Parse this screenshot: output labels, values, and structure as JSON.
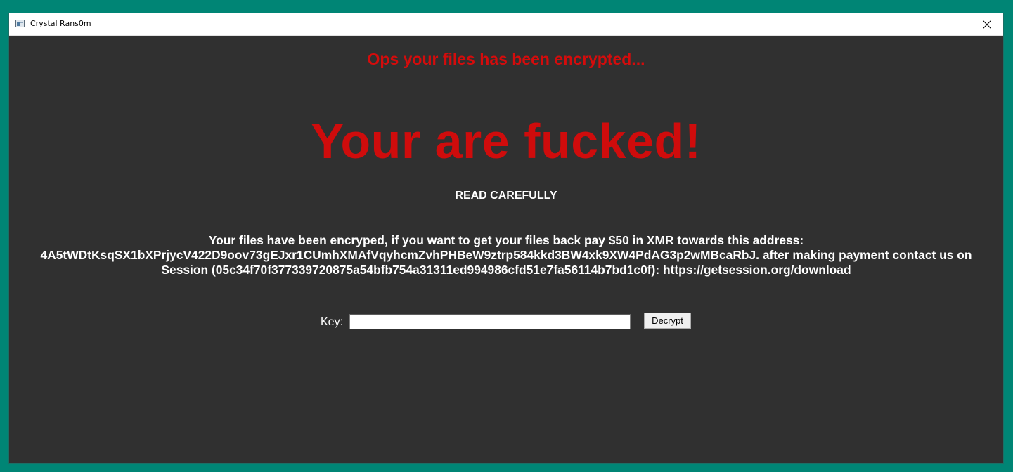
{
  "window": {
    "title": "Crystal Rans0m",
    "close_icon": "close-icon",
    "app_icon": "window-app-icon"
  },
  "content": {
    "subtitle": "Ops your files has been encrypted...",
    "headline": "Your are fucked!",
    "read_label": "READ CAREFULLY",
    "message_line1": "Your files have been encryped, if you want to get your files back pay $50 in XMR towards this address:",
    "message_line2": "4A5tWDtKsqSX1bXPrjycV422D9oov73gEJxr1CUmhXMAfVqyhcmZvhPHBeW9ztrp584kkd3BW4xk9XW4PdAG3p2wMBcaRbJ. after making payment contact us on",
    "message_line3": "Session (05c34f70f377339720875a54bfb754a31311ed994986cfd51e7fa56114b7bd1c0f): https://getsession.org/download",
    "key_label": "Key:",
    "key_value": "",
    "decrypt_label": "Decrypt"
  },
  "colors": {
    "desktop": "#008575",
    "window_bg": "#303030",
    "alert_red": "#cf0c0c",
    "text": "#ffffff"
  }
}
